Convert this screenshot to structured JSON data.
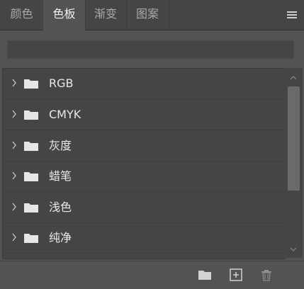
{
  "tabs": [
    {
      "label": "颜色"
    },
    {
      "label": "色板"
    },
    {
      "label": "渐变"
    },
    {
      "label": "图案"
    }
  ],
  "search": {
    "placeholder": "",
    "value": ""
  },
  "groups": [
    {
      "label": "RGB"
    },
    {
      "label": "CMYK"
    },
    {
      "label": "灰度"
    },
    {
      "label": "蜡笔"
    },
    {
      "label": "浅色"
    },
    {
      "label": "纯净"
    }
  ],
  "colors": {
    "panel_bg": "#535353",
    "list_bg": "#454545",
    "active_tab_text": "#f0f0f0",
    "inactive_tab_text": "#a9a9a9"
  },
  "icons": {
    "panel_menu": "menu-icon",
    "group_expand": "chevron-right-icon",
    "group_folder": "folder-icon",
    "new_group": "folder-icon",
    "new_swatch": "add-square-icon",
    "delete": "trash-icon"
  }
}
